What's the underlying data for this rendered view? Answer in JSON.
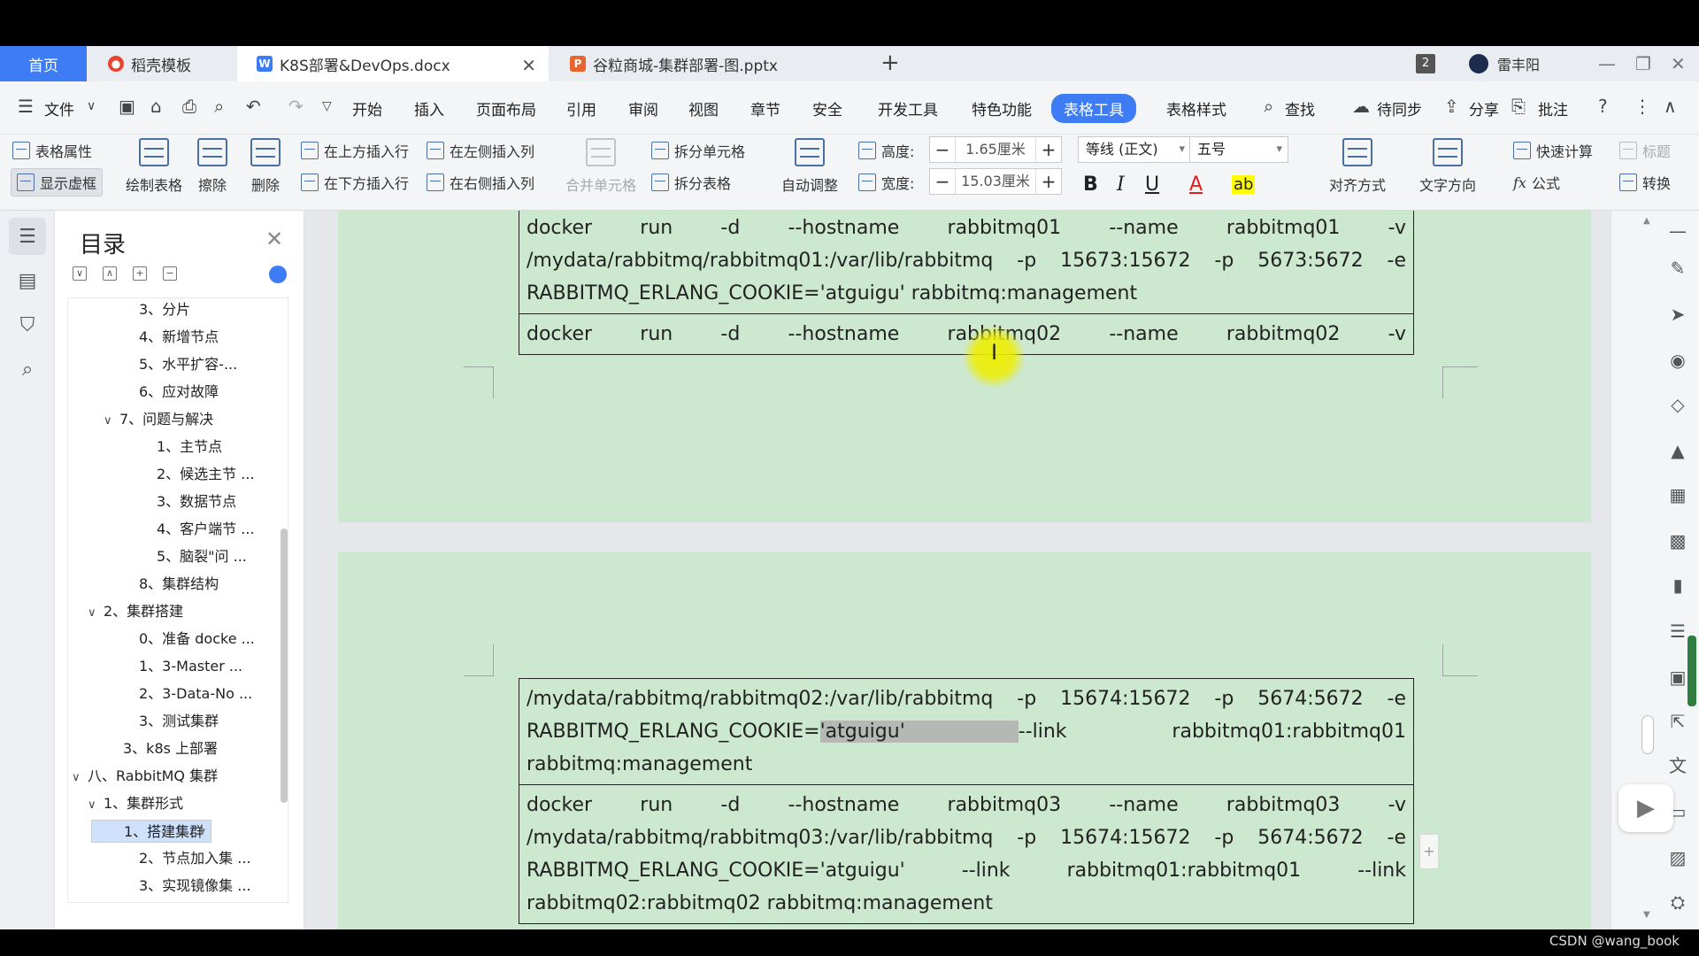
{
  "tabs": {
    "home": "首页",
    "template": "稻壳模板",
    "doc": "K8S部署&DevOps.docx",
    "ppt": "谷粒商城-集群部署-图.pptx",
    "add": "+",
    "window_count": "2",
    "user": "雷丰阳"
  },
  "menu": {
    "file": "文件",
    "items": [
      "开始",
      "插入",
      "页面布局",
      "引用",
      "审阅",
      "视图",
      "章节",
      "安全",
      "开发工具",
      "特色功能",
      "表格工具",
      "表格样式"
    ],
    "active": "表格工具",
    "search": "查找",
    "sync": "待同步",
    "share": "分享",
    "comment": "批注"
  },
  "ribbon": {
    "table_props": "表格属性",
    "show_gridlines": "显示虚框",
    "draw_table": "绘制表格",
    "erase": "擦除",
    "delete": "删除",
    "insert_row_above": "在上方插入行",
    "insert_row_below": "在下方插入行",
    "insert_col_left": "在左侧插入列",
    "insert_col_right": "在右侧插入列",
    "merge_cells": "合并单元格",
    "split_cells": "拆分单元格",
    "split_table": "拆分表格",
    "auto_fit": "自动调整",
    "height_label": "高度:",
    "height_value": "1.65厘米",
    "width_label": "宽度:",
    "width_value": "15.03厘米",
    "font_name": "等线 (正文)",
    "font_size": "五号",
    "align": "对齐方式",
    "text_dir": "文字方向",
    "quick_calc": "快速计算",
    "title_row": "标题",
    "formula": "公式",
    "convert": "转换"
  },
  "toc": {
    "title": "目录",
    "items": [
      {
        "label": "3、分片",
        "caret": ""
      },
      {
        "label": "4、新增节点",
        "caret": ""
      },
      {
        "label": "5、水平扩容-...",
        "caret": ""
      },
      {
        "label": "6、应对故障",
        "caret": ""
      },
      {
        "label": "7、问题与解决",
        "caret": "∨"
      },
      {
        "label": "1、主节点",
        "caret": ""
      },
      {
        "label": "2、候选主节 ...",
        "caret": ""
      },
      {
        "label": "3、数据节点",
        "caret": ""
      },
      {
        "label": "4、客户端节 ...",
        "caret": ""
      },
      {
        "label": "5、脑裂\"问 ...",
        "caret": ""
      },
      {
        "label": "8、集群结构",
        "caret": ""
      },
      {
        "label": "2、集群搭建",
        "caret": "∨"
      },
      {
        "label": "0、准备 docke ...",
        "caret": ""
      },
      {
        "label": "1、3-Master ...",
        "caret": ""
      },
      {
        "label": "2、3-Data-No ...",
        "caret": ""
      },
      {
        "label": "3、测试集群",
        "caret": ""
      },
      {
        "label": "3、k8s 上部署",
        "caret": ""
      },
      {
        "label": "八、RabbitMQ 集群",
        "caret": "∨"
      },
      {
        "label": "1、集群形式",
        "caret": "∨"
      },
      {
        "label": "1、搭建集群",
        "caret": ""
      },
      {
        "label": "2、节点加入集 ...",
        "caret": ""
      },
      {
        "label": "3、实现镜像集 ...",
        "caret": ""
      }
    ],
    "selected_index": 19
  },
  "document": {
    "page1_cell1": [
      "docker run -d --hostname rabbitmq01 --name rabbitmq01 -v",
      "/mydata/rabbitmq/rabbitmq01:/var/lib/rabbitmq -p 15673:15672 -p 5673:5672 -e",
      "RABBITMQ_ERLANG_COOKIE='atguigu' rabbitmq:management"
    ],
    "page1_cell2": "docker run -d --hostname rabbitmq02 --name rabbitmq02 -v",
    "page2_cell1": [
      "/mydata/rabbitmq/rabbitmq02:/var/lib/rabbitmq -p 15674:15672 -p 5674:5672 -e",
      "RABBITMQ_ERLANG_COOKIE=",
      "'atguigu'",
      "--link rabbitmq01:rabbitmq01",
      "rabbitmq:management"
    ],
    "page2_cell2": [
      "docker run -d --hostname rabbitmq03 --name rabbitmq03 -v",
      "/mydata/rabbitmq/rabbitmq03:/var/lib/rabbitmq -p 15674:15672 -p 5674:5672 -e",
      "RABBITMQ_ERLANG_COOKIE='atguigu' --link rabbitmq01:rabbitmq01 --link",
      "rabbitmq02:rabbitmq02 rabbitmq:management"
    ]
  },
  "status": {
    "watermark": "CSDN @wang_book"
  },
  "colors": {
    "accent": "#3d7cf4",
    "page_bg": "#cce8cf",
    "cursor_highlight": "#eeee00"
  }
}
